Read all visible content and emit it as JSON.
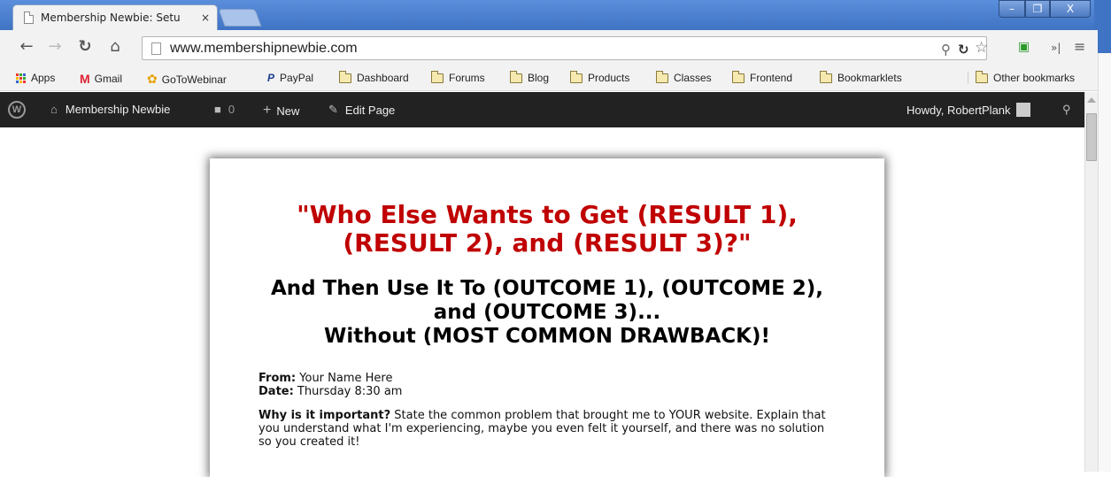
{
  "browser": {
    "tab_title": "Membership Newbie: Setu",
    "tab_close": "×",
    "url": "www.membershipnewbie.com",
    "window_buttons": {
      "minimize": "–",
      "maximize": "❐",
      "close": "X"
    }
  },
  "bookmarks": [
    {
      "label": "Apps",
      "icon": "apps-grid-icon"
    },
    {
      "label": "Gmail",
      "icon": "gmail-icon"
    },
    {
      "label": "GoToWebinar",
      "icon": "gotowebinar-icon"
    },
    {
      "label": "PayPal",
      "icon": "paypal-icon"
    },
    {
      "label": "Dashboard",
      "icon": "folder-icon"
    },
    {
      "label": "Forums",
      "icon": "folder-icon"
    },
    {
      "label": "Blog",
      "icon": "folder-icon"
    },
    {
      "label": "Products",
      "icon": "folder-icon"
    },
    {
      "label": "Classes",
      "icon": "folder-icon"
    },
    {
      "label": "Frontend",
      "icon": "folder-icon"
    },
    {
      "label": "Bookmarklets",
      "icon": "folder-icon"
    }
  ],
  "other_bookmarks": "Other bookmarks",
  "admin_bar": {
    "site_name": "Membership Newbie",
    "comments_count": "0",
    "new_label": "New",
    "edit_label": "Edit Page",
    "howdy": "Howdy, RobertPlank"
  },
  "page": {
    "headline_line1": "\"Who Else Wants to Get (RESULT 1),",
    "headline_line2": "(RESULT 2), and (RESULT 3)?\"",
    "subhead_line1": "And Then Use It To (OUTCOME 1), (OUTCOME 2),",
    "subhead_line2": "and (OUTCOME 3)...",
    "subhead_line3": "Without (MOST COMMON DRAWBACK)!",
    "from_label": "From:",
    "from_value": " Your Name Here",
    "date_label": "Date:",
    "date_value": " Thursday 8:30 am",
    "why_label": "Why is it important?",
    "why_text": " State the common problem that brought me to YOUR website. Explain that you understand what I'm experiencing, maybe you even felt it yourself, and there was no solution so you created it!"
  },
  "colors": {
    "headline": "#c00000",
    "admin_bar": "#222222",
    "chrome_frame": "#4a7fd0"
  }
}
